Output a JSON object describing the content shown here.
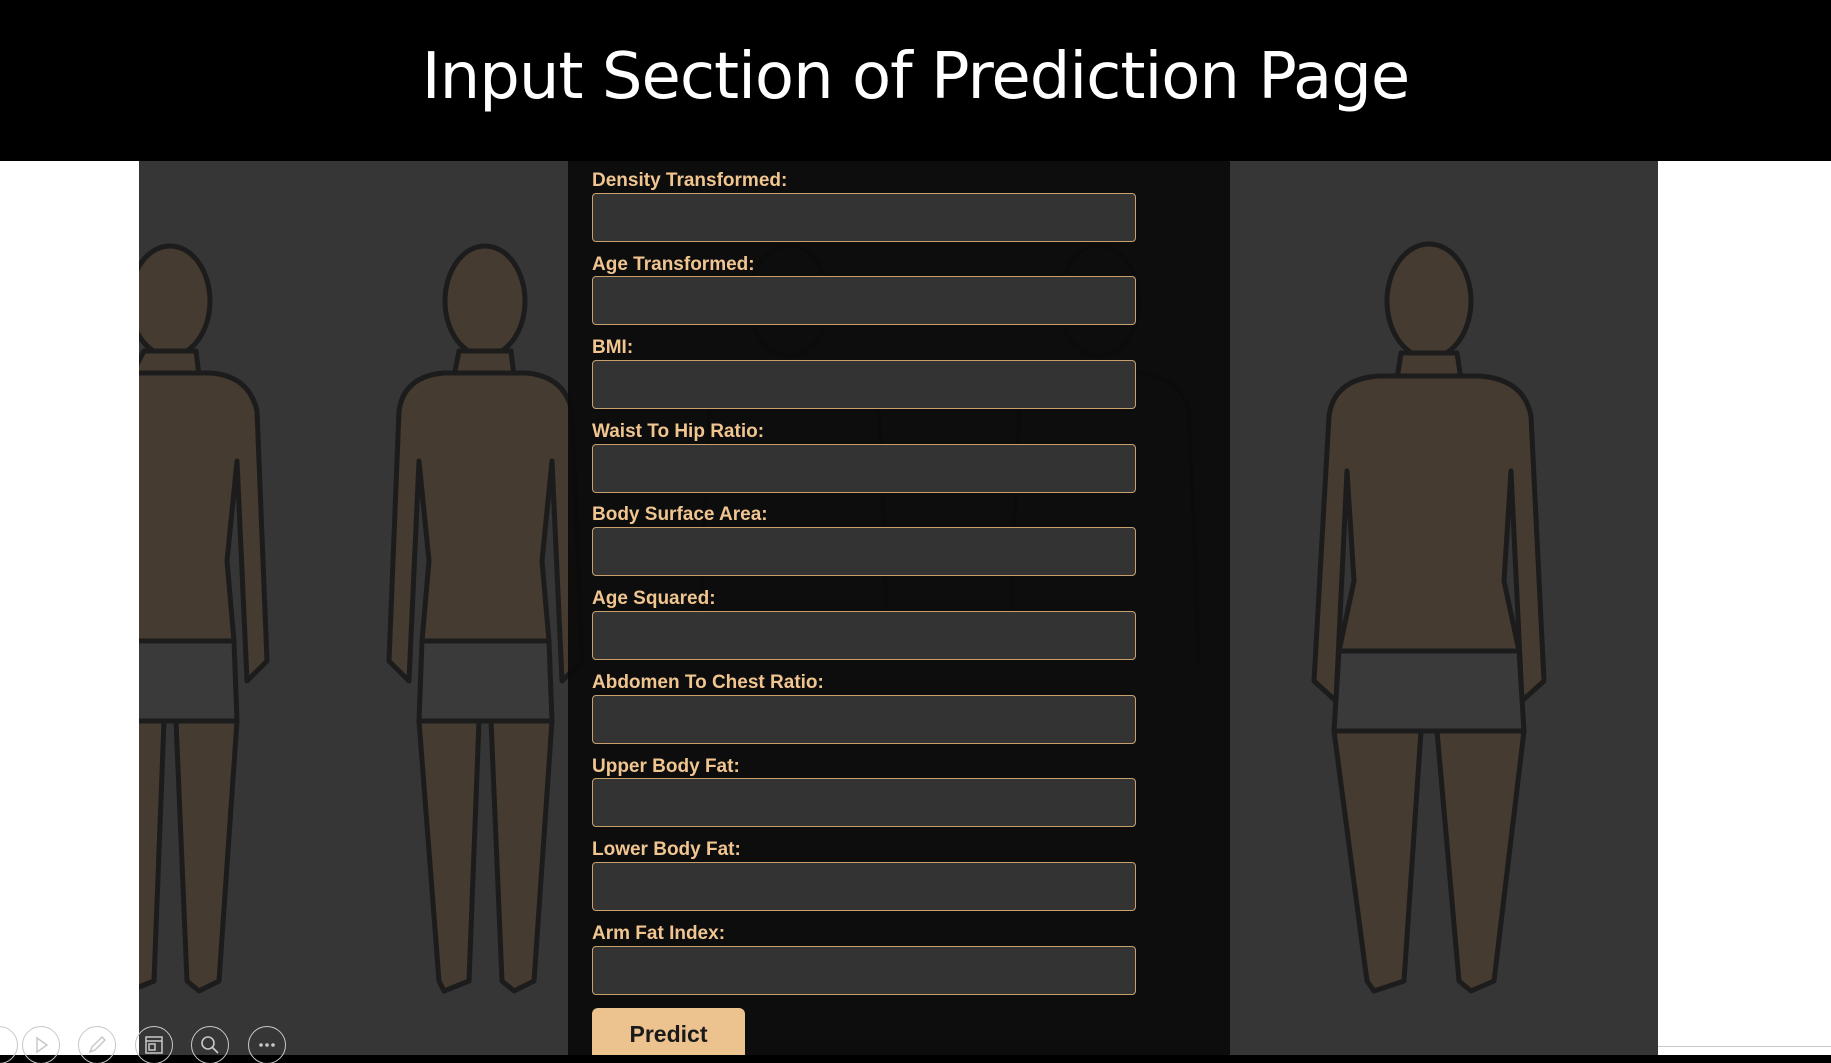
{
  "slide": {
    "title": "Input Section of Prediction Page"
  },
  "form": {
    "fields": [
      {
        "label": "Density Transformed:",
        "value": ""
      },
      {
        "label": "Age Transformed:",
        "value": ""
      },
      {
        "label": "BMI:",
        "value": ""
      },
      {
        "label": "Waist To Hip Ratio:",
        "value": ""
      },
      {
        "label": "Body Surface Area:",
        "value": ""
      },
      {
        "label": "Age Squared:",
        "value": ""
      },
      {
        "label": "Abdomen To Chest Ratio:",
        "value": ""
      },
      {
        "label": "Upper Body Fat:",
        "value": ""
      },
      {
        "label": "Lower Body Fat:",
        "value": ""
      },
      {
        "label": "Arm Fat Index:",
        "value": ""
      }
    ],
    "submit_label": "Predict"
  },
  "toolbar": {
    "icons": [
      "play-icon",
      "pen-icon",
      "slides-grid-icon",
      "zoom-icon",
      "more-icon"
    ]
  },
  "colors": {
    "header_background": "#000000",
    "label_color": "#f0c590",
    "input_border": "#c9a06b",
    "input_background": "#333333",
    "button_background": "#ecc28f",
    "page_background": "#363636"
  }
}
